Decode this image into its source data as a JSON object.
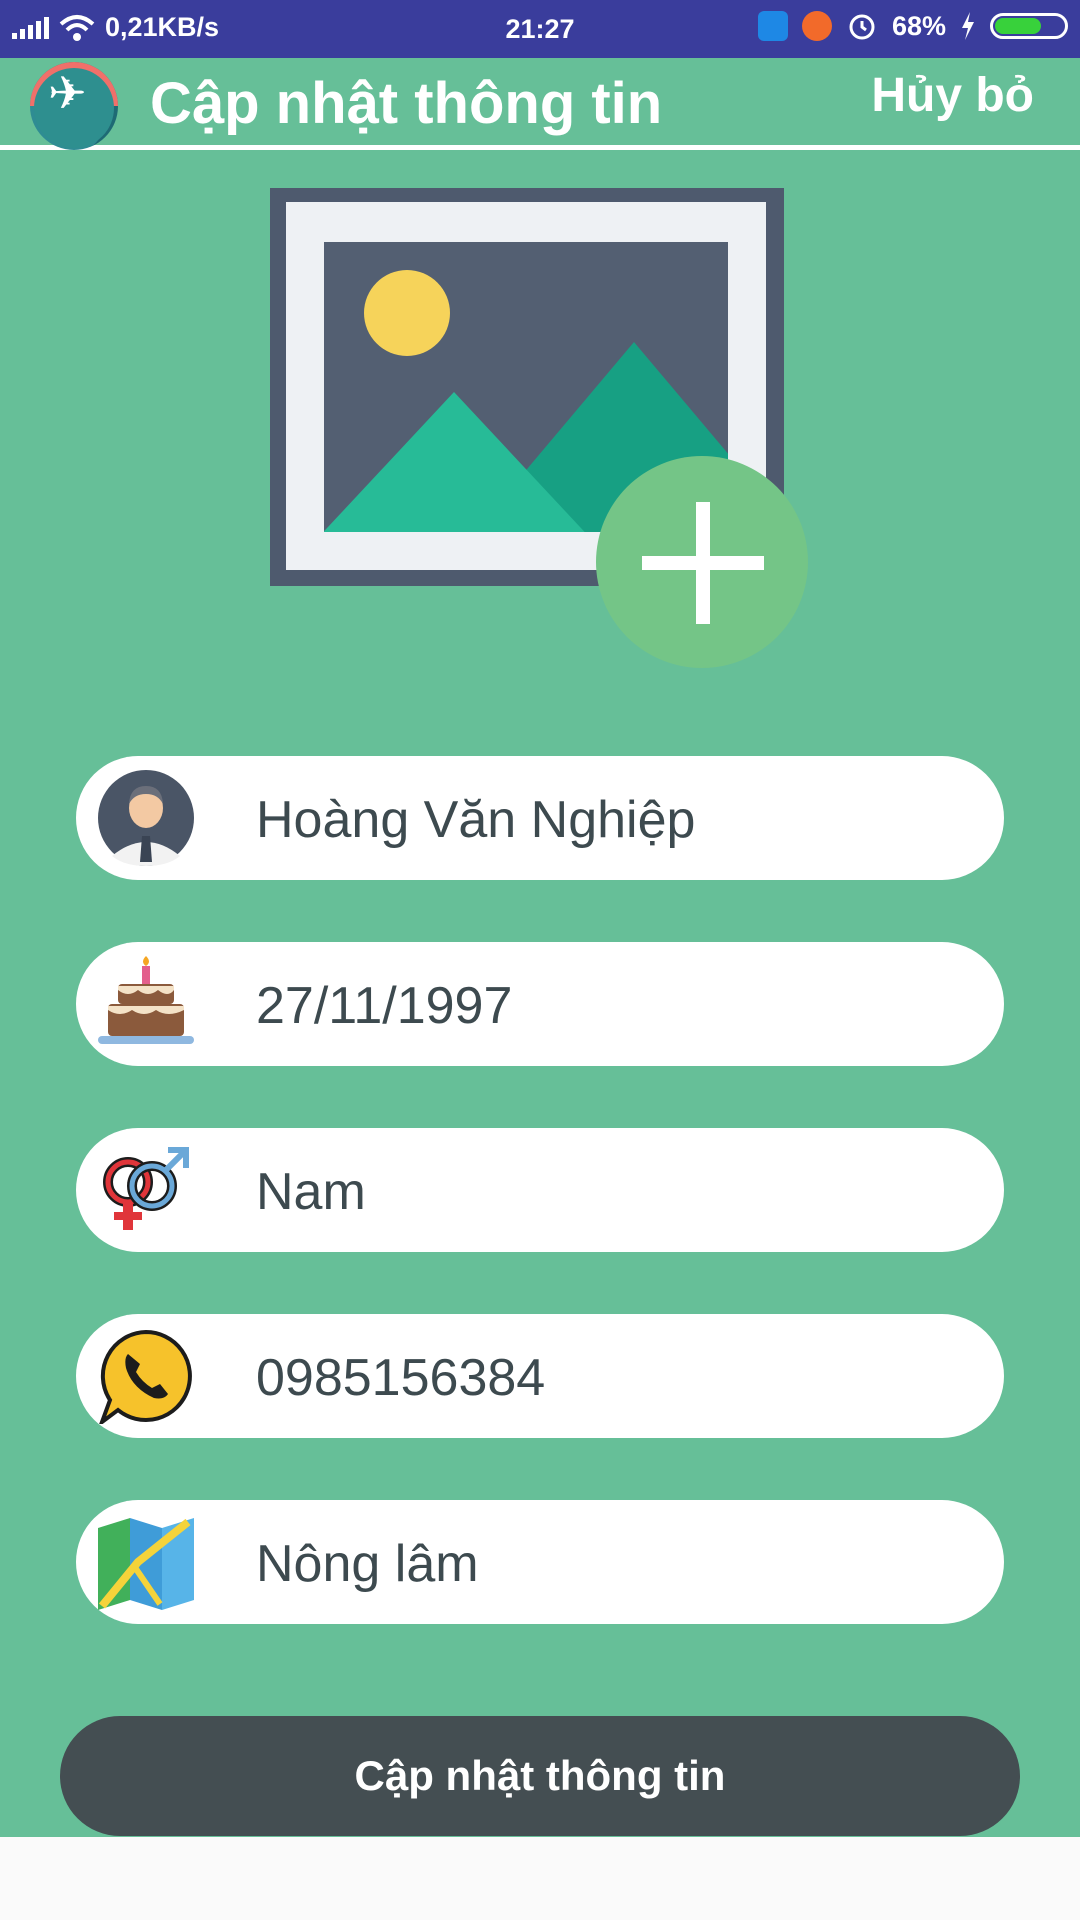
{
  "status_bar": {
    "network_speed": "0,21KB/s",
    "time": "21:27",
    "battery": "68%",
    "battery_level": 0.68
  },
  "header": {
    "title": "Cập nhật thông tin",
    "cancel_label": "Hủy bỏ"
  },
  "fields": {
    "name": {
      "value": "Hoàng Văn Nghiệp",
      "icon": "user-avatar-icon"
    },
    "birthday": {
      "value": "27/11/1997",
      "icon": "birthday-cake-icon"
    },
    "gender": {
      "value": "Nam",
      "icon": "gender-symbol-icon"
    },
    "phone": {
      "value": "0985156384",
      "icon": "phone-icon"
    },
    "address": {
      "value": "Nông lâm",
      "icon": "map-icon"
    }
  },
  "submit_label": "Cập nhật thông tin",
  "colors": {
    "status_bar": "#3a3d9c",
    "primary": "#66bf98",
    "button": "#444e52",
    "field_text": "#3d4a4f"
  }
}
